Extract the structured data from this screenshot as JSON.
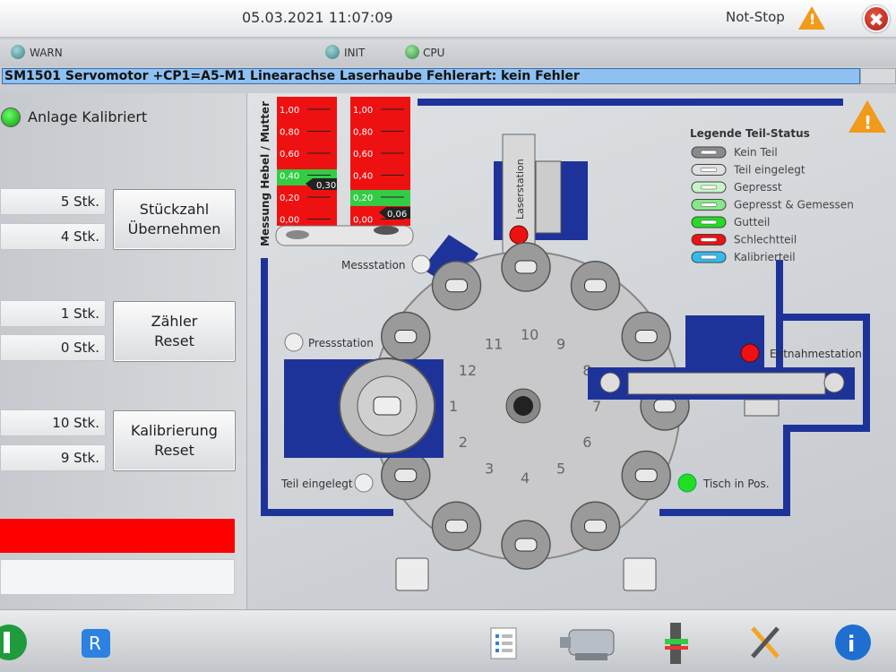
{
  "header": {
    "datetime": "05.03.2021 11:07:09",
    "notstop_label": "Not-Stop",
    "warning_symbol": "!",
    "close_symbol": "✖"
  },
  "status": {
    "warn_label": "WARN",
    "init_label": "INIT",
    "cpu_label": "CPU"
  },
  "message": "SM1501 Servomotor +CP1=A5-M1 Linearachse Laserhaube Fehlerart: kein Fehler",
  "left": {
    "calibrated_label": "Anlage Kalibriert",
    "group1": {
      "value1": "5 Stk.",
      "value2": "4 Stk.",
      "button_line1": "Stückzahl",
      "button_line2": "Übernehmen"
    },
    "group2": {
      "value1": "1 Stk.",
      "value2": "0 Stk.",
      "button_line1": "Zähler",
      "button_line2": "Reset"
    },
    "group3": {
      "value1": "10 Stk.",
      "value2": "9 Stk.",
      "button_line1": "Kalibrierung",
      "button_line2": "Reset"
    }
  },
  "machine": {
    "gauge_title": "Messung Hebel / Mutter",
    "gauge_ticks": [
      "1,00",
      "0,80",
      "0,60",
      "0,40",
      "0,20",
      "0,00"
    ],
    "gauge1_value": "0,30",
    "gauge2_value": "0,06",
    "stations": {
      "mess": "Messstation",
      "press": "Pressstation",
      "laser": "Laserstation",
      "entnahme": "Entnahmestation",
      "teil_eingelegt": "Teil eingelegt",
      "tisch_in_pos": "Tisch in Pos."
    },
    "positions": [
      "1",
      "2",
      "3",
      "4",
      "5",
      "6",
      "7",
      "8",
      "9",
      "10",
      "11",
      "12"
    ],
    "legend": {
      "title": "Legende Teil-Status",
      "items": [
        {
          "label": "Kein Teil",
          "color": "#8a8a8a"
        },
        {
          "label": "Teil eingelegt",
          "color": "#e0e0e0"
        },
        {
          "label": "Gepresst",
          "color": "#c8f5c8"
        },
        {
          "label": "Gepresst & Gemessen",
          "color": "#86e886"
        },
        {
          "label": "Gutteil",
          "color": "#22dd22"
        },
        {
          "label": "Schlechtteil",
          "color": "#ee1111"
        },
        {
          "label": "Kalibrierteil",
          "color": "#33bbee"
        }
      ]
    }
  },
  "footer": {
    "r_label": "R",
    "info_label": "i"
  }
}
